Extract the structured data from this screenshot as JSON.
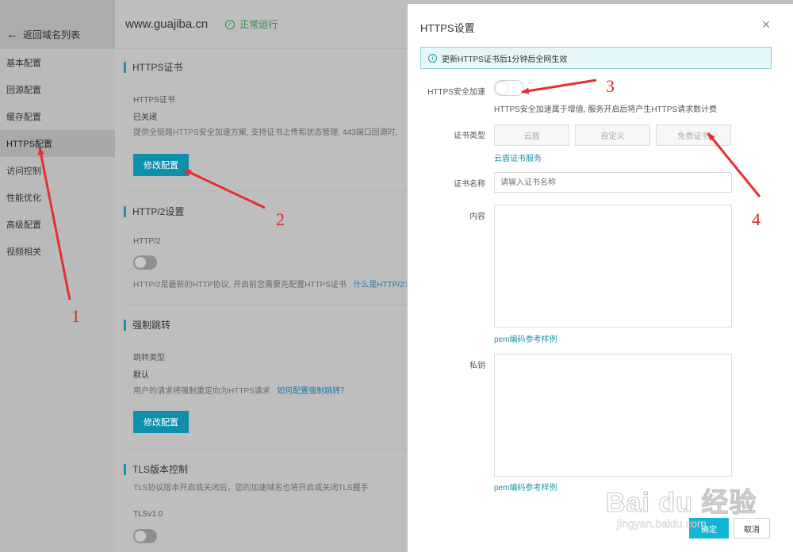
{
  "sidebar": {
    "back_label": "返回域名列表",
    "items": [
      {
        "label": "基本配置"
      },
      {
        "label": "回源配置"
      },
      {
        "label": "缓存配置"
      },
      {
        "label": "HTTPS配置",
        "active": true
      },
      {
        "label": "访问控制"
      },
      {
        "label": "性能优化"
      },
      {
        "label": "高级配置"
      },
      {
        "label": "视频相关"
      }
    ]
  },
  "header": {
    "domain": "www.guajiba.cn",
    "status": "正常运行"
  },
  "https_cert": {
    "title": "HTTPS证书",
    "label": "HTTPS证书",
    "value": "已关闭",
    "desc": "提供全链路HTTPS安全加速方案, 支持证书上传和状态管理. 443端口回源时,",
    "button": "修改配置"
  },
  "http2": {
    "title": "HTTP/2设置",
    "label": "HTTP/2",
    "desc": "HTTP/2是最新的HTTP协议, 开启前您需要先配置HTTPS证书",
    "link": "什么是HTTP/2?"
  },
  "redirect": {
    "title": "强制跳转",
    "label": "跳转类型",
    "value": "默认",
    "desc": "用户的请求将强制重定向为HTTPS请求",
    "link": "如何配置强制跳转？",
    "button": "修改配置"
  },
  "tls": {
    "title": "TLS版本控制",
    "desc": "TLS协议版本开启或关闭后，您的加速域名也将开启或关闭TLS握手",
    "label": "TLSv1.0"
  },
  "modal": {
    "title": "HTTPS设置",
    "notice": "更新HTTPS证书后1分钟后全网生效",
    "secure_label": "HTTPS安全加速",
    "secure_help": "HTTPS安全加速属于增值, 服务开启后将产生HTTPS请求数计费",
    "cert_type_label": "证书类型",
    "cert_types": [
      "云盾",
      "自定义",
      "免费证书"
    ],
    "cert_service_link": "云盾证书服务",
    "cert_name_label": "证书名称",
    "cert_name_placeholder": "请输入证书名称",
    "content_label": "内容",
    "pem_link_1": "pem编码参考样例",
    "key_label": "私钥",
    "pem_link_2": "pem编码参考样例",
    "ok": "确定",
    "cancel": "取消"
  },
  "annotations": [
    "1",
    "2",
    "3",
    "4"
  ],
  "watermark": {
    "main": "Bai du 经验",
    "sub": "jingyan.baidu.com"
  },
  "colors": {
    "accent": "#0f8fab",
    "arrow": "#e53030",
    "status_green": "#2e8a4e",
    "notice_bg": "#e5f6f8"
  }
}
